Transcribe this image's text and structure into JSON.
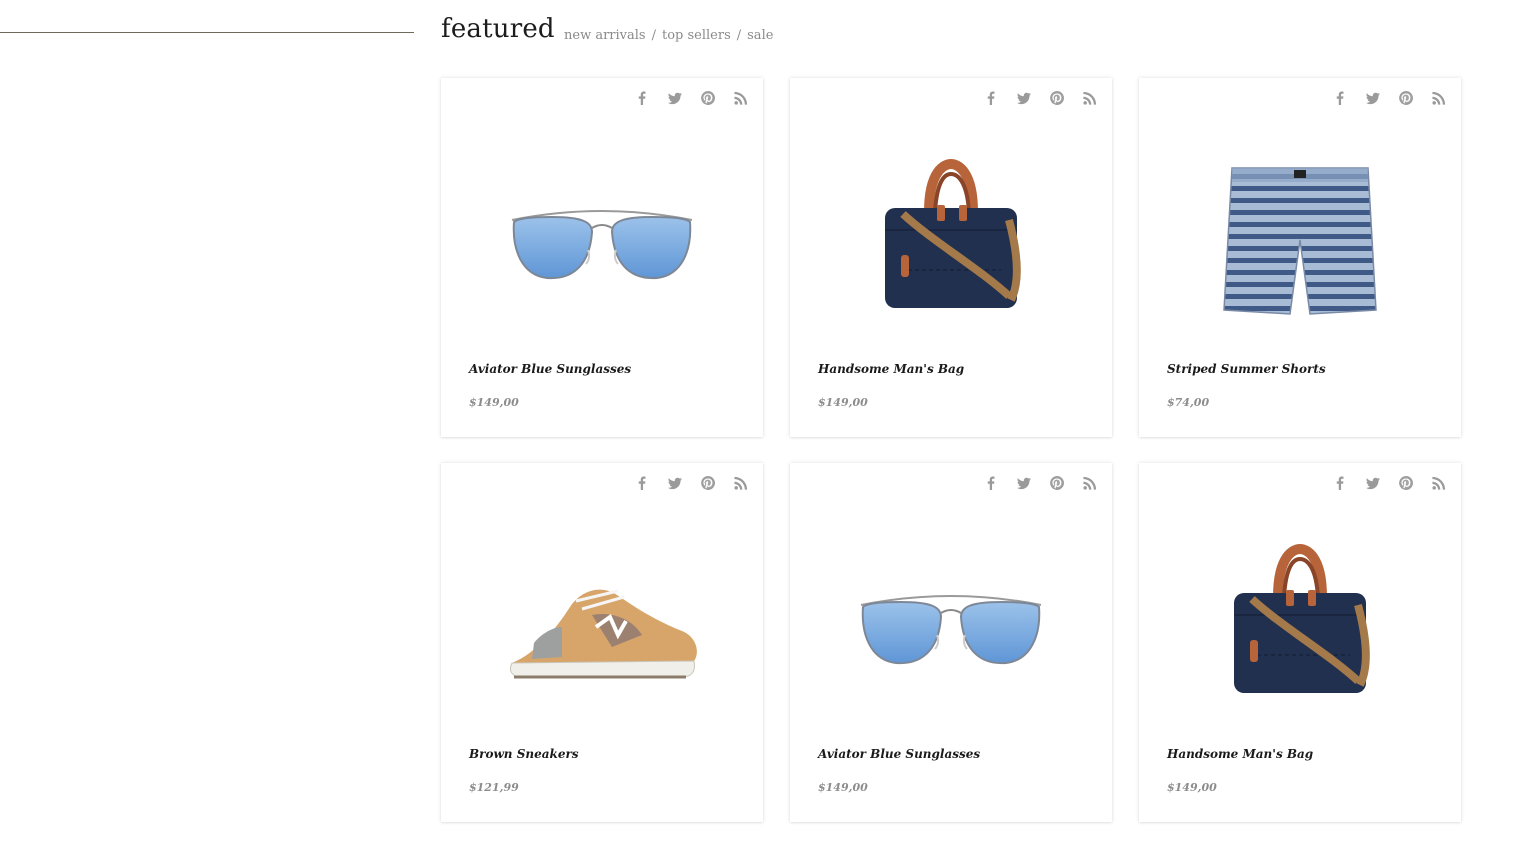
{
  "section": {
    "title": "featured",
    "filters": [
      "new arrivals",
      "top sellers",
      "sale"
    ],
    "separator": "/"
  },
  "colors": {
    "icon_gray": "#9a9a9a",
    "price_gray": "#8c8c8c",
    "text_dark": "#1a1a1a",
    "divider": "#6e6a5c"
  },
  "social_icons": [
    "facebook-icon",
    "twitter-icon",
    "pinterest-icon",
    "rss-icon"
  ],
  "products": [
    {
      "name": "Aviator Blue Sunglasses",
      "price": "$149,00",
      "image": "sunglasses"
    },
    {
      "name": "Handsome Man's Bag",
      "price": "$149,00",
      "image": "bag"
    },
    {
      "name": "Striped Summer Shorts",
      "price": "$74,00",
      "image": "shorts"
    },
    {
      "name": "Brown Sneakers",
      "price": "$121,99",
      "image": "sneakers"
    },
    {
      "name": "Aviator Blue Sunglasses",
      "price": "$149,00",
      "image": "sunglasses"
    },
    {
      "name": "Handsome Man's Bag",
      "price": "$149,00",
      "image": "bag"
    }
  ]
}
